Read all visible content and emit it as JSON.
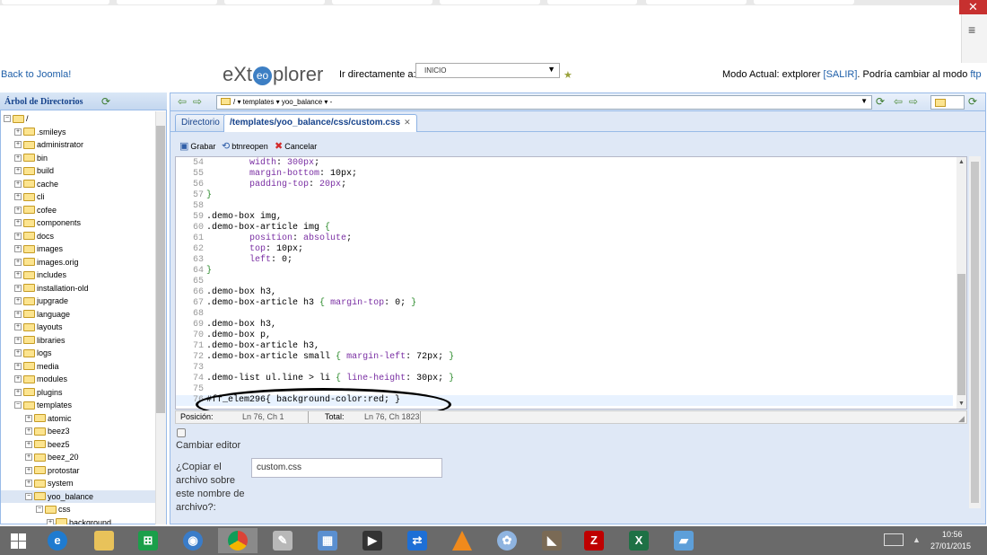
{
  "browser": {
    "close_glyph": "✕",
    "menu_glyph": "≡"
  },
  "header": {
    "back_link": "Back to Joomla!",
    "logo_pre": "eXt",
    "logo_post": "plorer",
    "goto_label": "Ir directamente a:",
    "goto_value": "INICIO",
    "mode_prefix": "Modo Actual: extplorer ",
    "logout": "[SALIR]",
    "mode_mid": ". Podría cambiar al modo ",
    "ftp": "ftp"
  },
  "tree": {
    "title": "Árbol de Directorios",
    "items": [
      {
        "label": "/",
        "depth": 0,
        "open": true
      },
      {
        "label": ".smileys",
        "depth": 1
      },
      {
        "label": "administrator",
        "depth": 1
      },
      {
        "label": "bin",
        "depth": 1
      },
      {
        "label": "build",
        "depth": 1
      },
      {
        "label": "cache",
        "depth": 1
      },
      {
        "label": "cli",
        "depth": 1
      },
      {
        "label": "cofee",
        "depth": 1
      },
      {
        "label": "components",
        "depth": 1
      },
      {
        "label": "docs",
        "depth": 1
      },
      {
        "label": "images",
        "depth": 1
      },
      {
        "label": "images.orig",
        "depth": 1
      },
      {
        "label": "includes",
        "depth": 1
      },
      {
        "label": "installation-old",
        "depth": 1
      },
      {
        "label": "jupgrade",
        "depth": 1
      },
      {
        "label": "language",
        "depth": 1
      },
      {
        "label": "layouts",
        "depth": 1
      },
      {
        "label": "libraries",
        "depth": 1
      },
      {
        "label": "logs",
        "depth": 1
      },
      {
        "label": "media",
        "depth": 1
      },
      {
        "label": "modules",
        "depth": 1
      },
      {
        "label": "plugins",
        "depth": 1
      },
      {
        "label": "templates",
        "depth": 1,
        "open": true
      },
      {
        "label": "atomic",
        "depth": 2
      },
      {
        "label": "beez3",
        "depth": 2
      },
      {
        "label": "beez5",
        "depth": 2
      },
      {
        "label": "beez_20",
        "depth": 2
      },
      {
        "label": "protostar",
        "depth": 2
      },
      {
        "label": "system",
        "depth": 2
      },
      {
        "label": "yoo_balance",
        "depth": 2,
        "open": true,
        "selected": true
      },
      {
        "label": "css",
        "depth": 3,
        "open": true
      },
      {
        "label": "background",
        "depth": 4
      }
    ]
  },
  "nav": {
    "path": "/ ▾  templates ▾  yoo_balance ▾  -"
  },
  "tabs": [
    {
      "label": "Directorio"
    },
    {
      "label": "/templates/yoo_balance/css/custom.css",
      "closable": "✕"
    }
  ],
  "toolbar": {
    "save": "Grabar",
    "reopen": "btnreopen",
    "cancel": "Cancelar"
  },
  "code": {
    "lines": [
      {
        "n": "54",
        "html": "        <span class=c-prop>width</span>: <span class=c-prop>300px</span>;"
      },
      {
        "n": "55",
        "html": "        <span class=c-prop>margin-bottom</span>: 10px;"
      },
      {
        "n": "56",
        "html": "        <span class=c-prop>padding-top</span>: <span class=c-prop>20px</span>;"
      },
      {
        "n": "57",
        "html": "<span class=c-br>}</span>"
      },
      {
        "n": "58",
        "html": ""
      },
      {
        "n": "59",
        "html": ".demo-box img,"
      },
      {
        "n": "60",
        "html": ".demo-box-article img <span class=c-br>{</span>"
      },
      {
        "n": "61",
        "html": "        <span class=c-prop>position</span>: <span class=c-prop>absolute</span>;"
      },
      {
        "n": "62",
        "html": "        <span class=c-prop>top</span>: 10px;"
      },
      {
        "n": "63",
        "html": "        <span class=c-prop>left</span>: 0;"
      },
      {
        "n": "64",
        "html": "<span class=c-br>}</span>"
      },
      {
        "n": "65",
        "html": ""
      },
      {
        "n": "66",
        "html": ".demo-box h3,"
      },
      {
        "n": "67",
        "html": ".demo-box-article h3 <span class=c-br>{</span> <span class=c-prop>margin-top</span>: 0; <span class=c-br>}</span>"
      },
      {
        "n": "68",
        "html": ""
      },
      {
        "n": "69",
        "html": ".demo-box h3,"
      },
      {
        "n": "70",
        "html": ".demo-box p,"
      },
      {
        "n": "71",
        "html": ".demo-box-article h3,"
      },
      {
        "n": "72",
        "html": ".demo-box-article small <span class=c-br>{</span> <span class=c-prop>margin-left</span>: 72px; <span class=c-br>}</span>"
      },
      {
        "n": "73",
        "html": ""
      },
      {
        "n": "74",
        "html": ".demo-list ul.line &gt; li <span class=c-br>{</span> <span class=c-prop>line-height</span>: 30px; <span class=c-br>}</span>"
      },
      {
        "n": "75",
        "html": ""
      },
      {
        "n": "76",
        "html": "#ff_elem296{ background-color:red; }"
      }
    ]
  },
  "status": {
    "pos_label": "Posición:",
    "pos_value": "Ln 76, Ch 1",
    "tot_label": "Total:",
    "tot_value": "Ln 76, Ch 1823"
  },
  "form": {
    "change_editor": "Cambiar editor",
    "copy_label": "¿Copiar el archivo sobre este nombre de archivo?:",
    "copy_value": "custom.css"
  },
  "taskbar": {
    "time": "10:56",
    "date": "27/01/2015"
  }
}
